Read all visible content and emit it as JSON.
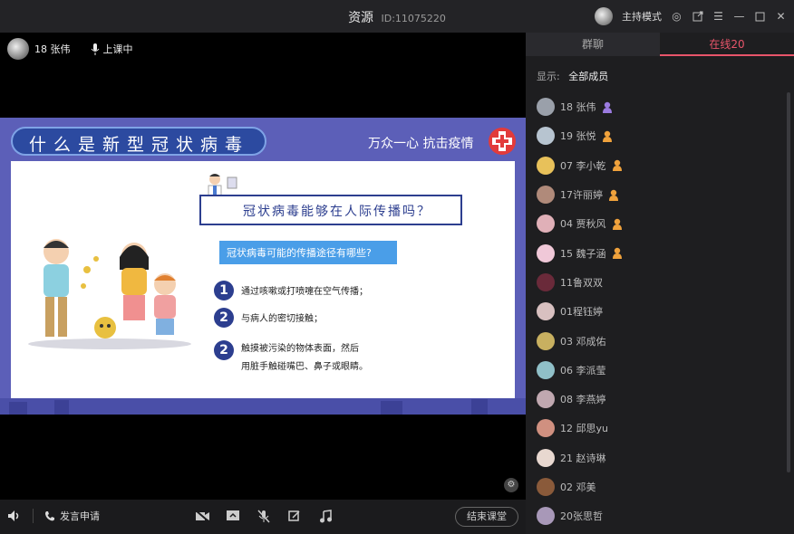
{
  "titlebar": {
    "title": "资源",
    "id_label": "ID:11075220",
    "mode_label": "主持模式"
  },
  "video": {
    "user_label": "18 张伟",
    "status_label": "上课中"
  },
  "slide": {
    "header": "什么是新型冠状病毒",
    "slogan": "万众一心 抗击疫情",
    "question": "冠状病毒能够在人际传播吗？",
    "subtitle": "冠状病毒可能的传播途径有哪些?",
    "items": [
      {
        "num": "1",
        "text": "通过咳嗽或打喷嚏在空气传播；"
      },
      {
        "num": "2",
        "text": "与病人的密切接触；"
      },
      {
        "num": "2",
        "text": "触摸被污染的物体表面，然后\n用脏手触碰嘴巴、鼻子或眼睛。"
      }
    ]
  },
  "bottombar": {
    "speak_request": "发言申请",
    "end_class": "结束课堂"
  },
  "panel": {
    "tab_chat": "群聊",
    "tab_online": "在线20",
    "filter_label": "显示:",
    "filter_value": "全部成员",
    "members": [
      {
        "name": "18 张伟",
        "avatar": "#9aa0aa",
        "icon": "teacher",
        "icon_color": "#9b7be0"
      },
      {
        "name": "19  张悦",
        "avatar": "#b7c4d0",
        "icon": "student",
        "icon_color": "#f0a23c"
      },
      {
        "name": "07 李小乾",
        "avatar": "#e8c15a",
        "icon": "student",
        "icon_color": "#f0a23c"
      },
      {
        "name": "17许丽婷",
        "avatar": "#b08a7a",
        "icon": "student",
        "icon_color": "#f0a23c"
      },
      {
        "name": "04 贾秋风",
        "avatar": "#e0b0b8",
        "icon": "student",
        "icon_color": "#f0a23c"
      },
      {
        "name": "15  魏子涵",
        "avatar": "#f0c8d8",
        "icon": "student",
        "icon_color": "#f0a23c"
      },
      {
        "name": "11鲁双双",
        "avatar": "#6a2a3a",
        "icon": "",
        "icon_color": ""
      },
      {
        "name": "01程钰婷",
        "avatar": "#d8c0c0",
        "icon": "",
        "icon_color": ""
      },
      {
        "name": "03 邓成佑",
        "avatar": "#c8b060",
        "icon": "",
        "icon_color": ""
      },
      {
        "name": "06 李派莹",
        "avatar": "#90c0c8",
        "icon": "",
        "icon_color": ""
      },
      {
        "name": " 08 李燕婷",
        "avatar": "#c0a8b0",
        "icon": "",
        "icon_color": ""
      },
      {
        "name": "12 邱思yu",
        "avatar": "#d09080",
        "icon": "",
        "icon_color": ""
      },
      {
        "name": "21 赵诗琳",
        "avatar": "#e8d8d0",
        "icon": "",
        "icon_color": ""
      },
      {
        "name": "02  邓美",
        "avatar": "#8a5a3a",
        "icon": "",
        "icon_color": ""
      },
      {
        "name": "20张思哲",
        "avatar": "#a898b8",
        "icon": "",
        "icon_color": ""
      }
    ]
  }
}
